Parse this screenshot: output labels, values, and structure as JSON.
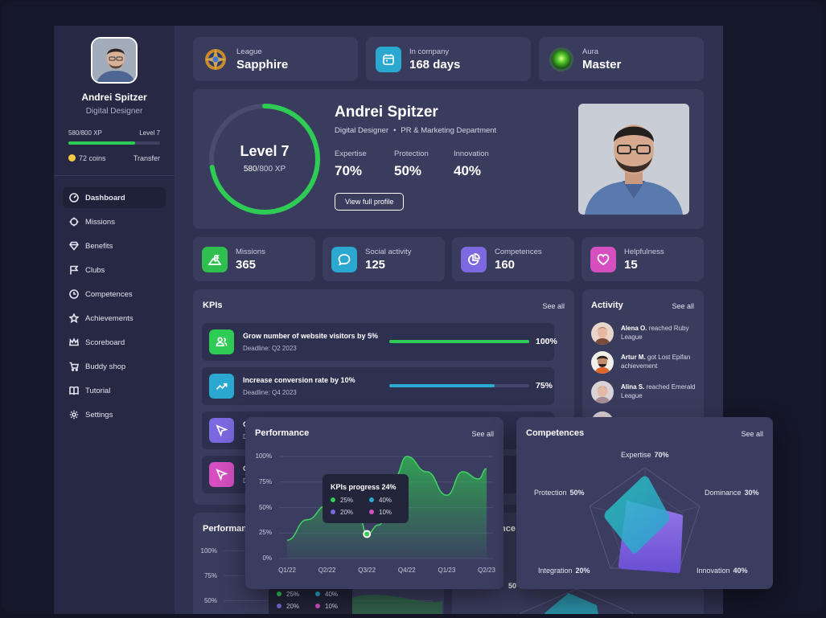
{
  "profile": {
    "name": "Andrei Spitzer",
    "role": "Digital Designer",
    "xp_label": "580/800 XP",
    "level_label": "Level 7",
    "xp_progress": 0.725,
    "coins": "72 coins",
    "transfer": "Transfer"
  },
  "sidebar": {
    "items": [
      {
        "label": "Dashboard",
        "icon": "dashboard-icon"
      },
      {
        "label": "Missions",
        "icon": "target-icon"
      },
      {
        "label": "Benefits",
        "icon": "diamond-icon"
      },
      {
        "label": "Clubs",
        "icon": "flag-icon"
      },
      {
        "label": "Competences",
        "icon": "clock-icon"
      },
      {
        "label": "Achievements",
        "icon": "star-icon"
      },
      {
        "label": "Scoreboard",
        "icon": "crown-icon"
      },
      {
        "label": "Buddy shop",
        "icon": "cart-icon"
      },
      {
        "label": "Tutorial",
        "icon": "book-icon"
      },
      {
        "label": "Settings",
        "icon": "gear-icon"
      }
    ]
  },
  "top_cards": [
    {
      "label": "League",
      "value": "Sapphire",
      "icon": "league-emblem-icon"
    },
    {
      "label": "In company",
      "value": "168 days",
      "icon": "calendar-icon"
    },
    {
      "label": "Aura",
      "value": "Master",
      "icon": "aura-orb-icon"
    }
  ],
  "hero": {
    "level": "Level 7",
    "xp": "580",
    "xp_total": "/800 XP",
    "progress": 0.725,
    "name": "Andrei Spitzer",
    "role": "Digital Designer",
    "department": "PR & Marketing Department",
    "stats": [
      {
        "label": "Expertise",
        "value": "70%"
      },
      {
        "label": "Protection",
        "value": "50%"
      },
      {
        "label": "Innovation",
        "value": "40%"
      }
    ],
    "button": "View full profile"
  },
  "stats": [
    {
      "label": "Missions",
      "value": "365",
      "color": "#2fbf4f",
      "icon": "mountain-flag-icon"
    },
    {
      "label": "Social activity",
      "value": "125",
      "color": "#2aa8d0",
      "icon": "chat-bubble-icon"
    },
    {
      "label": "Competences",
      "value": "160",
      "color": "#7c68e0",
      "icon": "pie-chart-icon"
    },
    {
      "label": "Helpfulness",
      "value": "15",
      "color": "#d54fc0",
      "icon": "heart-icon"
    }
  ],
  "kpis": {
    "title": "KPIs",
    "see_all": "See all",
    "items": [
      {
        "title": "Grow number of website visitors by 5%",
        "deadline": "Deadline: Q2 2023",
        "progress": 1.0,
        "pct": "100%",
        "color": "#2ecc55",
        "icon": "users-icon"
      },
      {
        "title": "Increase conversion rate by 10%",
        "deadline": "Deadline: Q4 2023",
        "progress": 0.75,
        "pct": "75%",
        "color": "#2aa8d0",
        "icon": "trend-up-icon"
      },
      {
        "title": "G",
        "deadline": "D",
        "color": "#7c68e0",
        "icon": "cursor-icon"
      },
      {
        "title": "G",
        "deadline": "D",
        "color": "#d54fc0",
        "icon": "cursor-icon"
      }
    ]
  },
  "activity": {
    "title": "Activity",
    "see_all": "See all",
    "items": [
      {
        "name": "Alena O.",
        "text": " reached Ruby League"
      },
      {
        "name": "Artur M.",
        "text": " got Lost Epifan achievement"
      },
      {
        "name": "Alina S.",
        "text": " reached Emerald League"
      }
    ]
  },
  "performance": {
    "title": "Performance",
    "see_all": "See all",
    "tooltip_title": "KPIs progress 24%",
    "tooltip_items": [
      {
        "value": "25%",
        "color": "#2ecc55"
      },
      {
        "value": "40%",
        "color": "#2aa8d0"
      },
      {
        "value": "20%",
        "color": "#7c68e0"
      },
      {
        "value": "10%",
        "color": "#d54fc0"
      }
    ]
  },
  "background_performance": {
    "title": "Performan",
    "y_ticks": [
      "100%",
      "75%",
      "50%"
    ],
    "legend": [
      "25%",
      "40%",
      "20%",
      "10%"
    ],
    "competences_fragment": "nce",
    "value_fragment": "50"
  },
  "competences": {
    "title": "Competences",
    "see_all": "See all",
    "axes": [
      {
        "label": "Expertise",
        "value": "70%"
      },
      {
        "label": "Dominance",
        "value": "30%"
      },
      {
        "label": "Innovation",
        "value": "40%"
      },
      {
        "label": "Integration",
        "value": "20%"
      },
      {
        "label": "Protection",
        "value": "50%"
      }
    ]
  },
  "chart_data": {
    "type": "area",
    "title": "Performance",
    "categories": [
      "Q1/22",
      "Q2/22",
      "Q3/22",
      "Q4/22",
      "Q1/23",
      "Q2/23"
    ],
    "y_ticks": [
      "100%",
      "75%",
      "50%",
      "25%",
      "0%"
    ],
    "ylim": [
      0,
      100
    ],
    "series": [
      {
        "x": [
          0,
          0.5,
          1,
          1.5,
          1.8,
          2,
          2.3,
          2.7,
          3,
          3.5,
          4,
          4.4,
          4.8,
          5
        ],
        "values": [
          18,
          38,
          52,
          58,
          42,
          24,
          33,
          80,
          100,
          85,
          62,
          85,
          78,
          88
        ]
      }
    ],
    "highlight": {
      "x": 2,
      "y": 24
    },
    "grid": true
  }
}
